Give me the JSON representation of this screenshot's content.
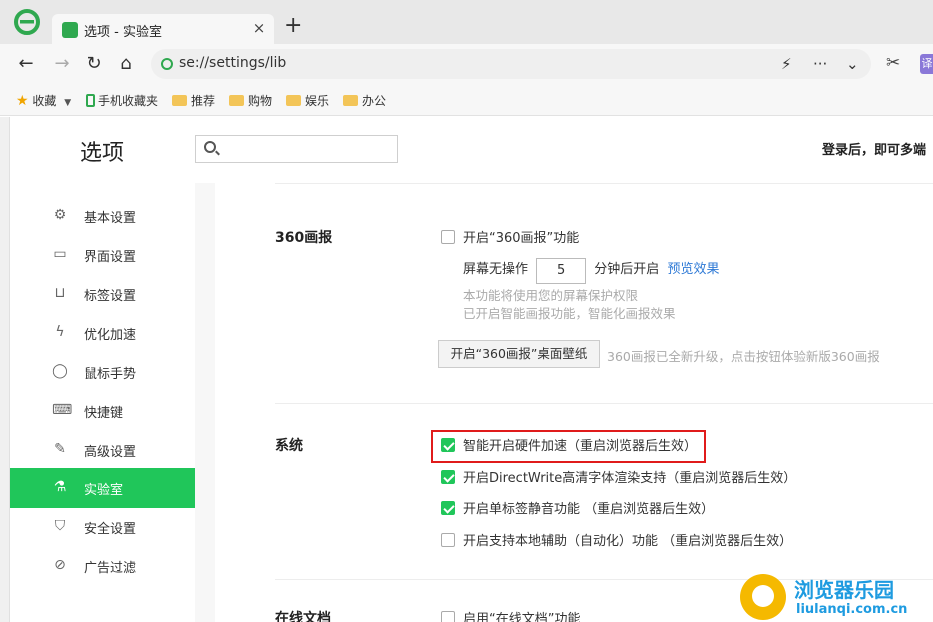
{
  "browser": {
    "tab": {
      "title": "选项 - 实验室",
      "close": "×"
    },
    "new_tab": "+",
    "address": {
      "url": "se://settings/lib"
    },
    "toolbar": {
      "more": "···",
      "dropdown": "⌄",
      "badge": "译"
    },
    "bookmarks": [
      {
        "label": "收藏",
        "type": "star"
      },
      {
        "label": "手机收藏夹",
        "type": "phone"
      },
      {
        "label": "推荐",
        "type": "folder"
      },
      {
        "label": "购物",
        "type": "folder"
      },
      {
        "label": "娱乐",
        "type": "folder"
      },
      {
        "label": "办公",
        "type": "folder"
      }
    ]
  },
  "header": {
    "title": "选项",
    "search_placeholder": "",
    "login_hint": "登录后，即可多端"
  },
  "sidebar": {
    "items": [
      {
        "label": "基本设置",
        "icon": "gear-icon",
        "active": false
      },
      {
        "label": "界面设置",
        "icon": "window-icon",
        "active": false
      },
      {
        "label": "标签设置",
        "icon": "tab-icon",
        "active": false
      },
      {
        "label": "优化加速",
        "icon": "lightning-icon",
        "active": false
      },
      {
        "label": "鼠标手势",
        "icon": "mouse-icon",
        "active": false
      },
      {
        "label": "快捷键",
        "icon": "keyboard-icon",
        "active": false
      },
      {
        "label": "高级设置",
        "icon": "wrench-icon",
        "active": false
      },
      {
        "label": "实验室",
        "icon": "flask-icon",
        "active": true
      },
      {
        "label": "安全设置",
        "icon": "shield-icon",
        "active": false
      },
      {
        "label": "广告过滤",
        "icon": "block-icon",
        "active": false
      }
    ]
  },
  "sections": {
    "pictorial": {
      "title": "360画报",
      "enable_label": "开启“360画报”功能",
      "enable_checked": false,
      "idle_prefix": "屏幕无操作",
      "idle_value": "5",
      "idle_suffix": "分钟后开启",
      "preview_link": "预览效果",
      "note1": "本功能将使用您的屏幕保护权限",
      "note2": "已开启智能画报功能，智能化画报效果",
      "wallpaper_button": "开启“360画报”桌面壁纸",
      "wallpaper_note": "360画报已全新升级，点击按钮体验新版360画报"
    },
    "system": {
      "title": "系统",
      "options": [
        {
          "label": "智能开启硬件加速（重启浏览器后生效）",
          "checked": true
        },
        {
          "label": "开启DirectWrite高清字体渲染支持（重启浏览器后生效）",
          "checked": true
        },
        {
          "label": "开启单标签静音功能 （重启浏览器后生效）",
          "checked": true
        },
        {
          "label": "开启支持本地辅助（自动化）功能 （重启浏览器后生效）",
          "checked": false
        }
      ]
    },
    "online_docs": {
      "title": "在线文档",
      "enable_label": "启用“在线文档”功能",
      "enable_checked": false
    }
  },
  "watermark": {
    "title": "浏览器乐园",
    "url": "liulanqi.com.cn"
  }
}
